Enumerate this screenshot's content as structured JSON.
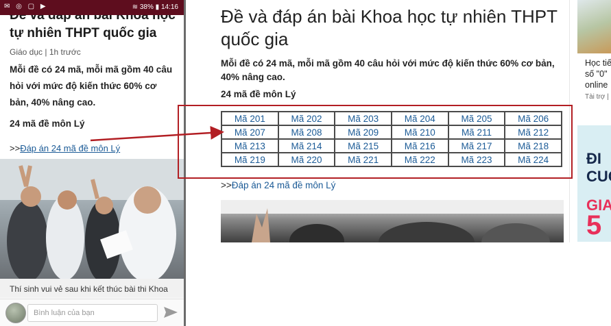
{
  "phone": {
    "status": {
      "signal": "38%",
      "time": "14:16"
    },
    "title": "Đề và đáp án bài Khoa học tự nhiên THPT quốc gia",
    "meta": "Giáo dục | 1h trước",
    "sapo": "Mỗi đề có 24 mã, mỗi mã gồm 40 câu hỏi với mức độ kiến thức 60% cơ bản, 40% nâng cao.",
    "section": "24 mã đề môn Lý",
    "answer_prefix": ">>",
    "answer_link": "Đáp án 24 mã đề môn Lý",
    "caption": "Thí sinh vui vẻ sau khi kết thúc bài thi Khoa",
    "comment_placeholder": "Bình luận của bạn"
  },
  "article": {
    "title": "Đề và đáp án bài Khoa học tự nhiên THPT quốc gia",
    "sapo": "Mỗi đề có 24 mã, mỗi mã gồm 40 câu hỏi với mức độ kiến thức 60% cơ bản, 40% nâng cao.",
    "section": "24 mã đề môn Lý",
    "codes": [
      [
        "Mã 201",
        "Mã 202",
        "Mã 203",
        "Mã 204",
        "Mã 205",
        "Mã 206"
      ],
      [
        "Mã 207",
        "Mã 208",
        "Mã 209",
        "Mã 210",
        "Mã 211",
        "Mã 212"
      ],
      [
        "Mã 213",
        "Mã 214",
        "Mã 215",
        "Mã 216",
        "Mã 217",
        "Mã 218"
      ],
      [
        "Mã 219",
        "Mã 220",
        "Mã 221",
        "Mã 222",
        "Mã 223",
        "Mã 224"
      ]
    ],
    "answer_prefix": ">>",
    "answer_link": "Đáp án 24 mã đề môn Lý"
  },
  "sidebar": {
    "text_lines": [
      "Học tiế",
      "số \"0\"",
      "online"
    ],
    "sponsor": "Tài trợ |",
    "ad_lines": [
      "ĐI",
      "CUC",
      "GIA",
      "5"
    ]
  },
  "colors": {
    "status_bar": "#5e0d1e",
    "link": "#1a5a96",
    "annotation": "#b21e23",
    "ad_background": "#d9eef3",
    "ad_accent": "#e8305a"
  }
}
